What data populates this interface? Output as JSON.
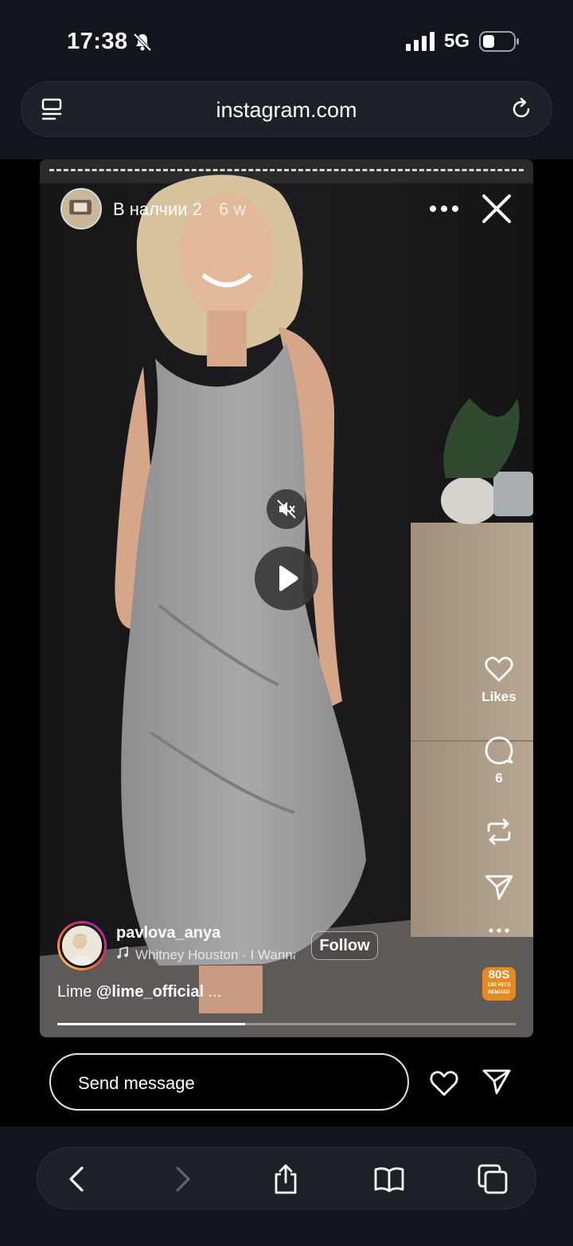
{
  "status": {
    "time": "17:38",
    "network": "5G"
  },
  "browser": {
    "url": "instagram.com"
  },
  "story": {
    "title": "В налчии 2",
    "age": "6 w"
  },
  "actions": {
    "likes_label": "Likes",
    "comments_count": "6"
  },
  "post": {
    "author": "pavlova_anya",
    "music": "Whitney Houston · I Wanna Dance",
    "follow_label": "Follow",
    "caption_prefix": "Lime",
    "caption_mention": "@lime_official",
    "caption_more": " ...",
    "audio_cover_text": "80S",
    "audio_cover_sub": "100 HITS",
    "audio_cover_sub2": "REMIXED",
    "progress": 0.41
  },
  "message": {
    "placeholder": "Send message"
  },
  "colors": {
    "background": "#000000",
    "bars": "#11151c",
    "accent_ring": "#d62976"
  },
  "icons": [
    "bell-slash-icon",
    "signal-icon",
    "battery-icon",
    "tabs-icon",
    "reload-icon",
    "more-icon",
    "close-icon",
    "mute-icon",
    "play-icon",
    "heart-icon",
    "comment-icon",
    "repost-icon",
    "send-icon",
    "back-icon",
    "forward-icon",
    "share-icon",
    "bookmarks-icon",
    "tabs-overview-icon"
  ]
}
